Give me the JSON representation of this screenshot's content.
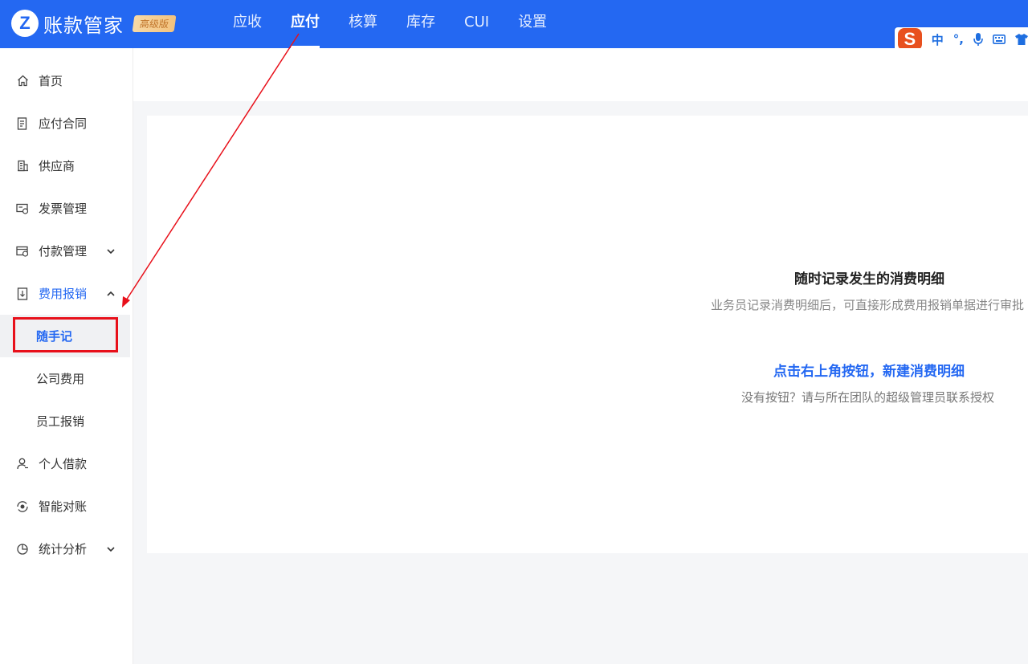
{
  "app": {
    "logo_letter": "Z",
    "name": "账款管家",
    "edition": "高级版"
  },
  "nav": {
    "items": [
      {
        "label": "应收",
        "active": false
      },
      {
        "label": "应付",
        "active": true
      },
      {
        "label": "核算",
        "active": false
      },
      {
        "label": "库存",
        "active": false
      },
      {
        "label": "CUI",
        "active": false
      },
      {
        "label": "设置",
        "active": false
      }
    ]
  },
  "ime_toolbar": {
    "logo": "S",
    "lang": "中",
    "punct": "°,",
    "icons": [
      "microphone-icon",
      "keyboard-icon",
      "skin-icon"
    ]
  },
  "sidebar": {
    "items": [
      {
        "label": "首页",
        "icon": "home-icon"
      },
      {
        "label": "应付合同",
        "icon": "contract-icon"
      },
      {
        "label": "供应商",
        "icon": "building-icon"
      },
      {
        "label": "发票管理",
        "icon": "invoice-icon"
      },
      {
        "label": "付款管理",
        "icon": "payment-icon",
        "chevron": "down"
      },
      {
        "label": "费用报销",
        "icon": "reimburse-icon",
        "chevron": "up",
        "expanded": true
      },
      {
        "label": "随手记",
        "sub": true,
        "selected": true
      },
      {
        "label": "公司费用",
        "sub": true
      },
      {
        "label": "员工报销",
        "sub": true
      },
      {
        "label": "个人借款",
        "icon": "user-icon"
      },
      {
        "label": "智能对账",
        "icon": "reconcile-icon"
      },
      {
        "label": "统计分析",
        "icon": "pie-chart-icon",
        "chevron": "down"
      }
    ]
  },
  "empty_state": {
    "title": "随时记录发生的消费明细",
    "description": "业务员记录消费明细后，可直接形成费用报销单据进行审批",
    "action": "点击右上角按钮，新建消费明细",
    "hint": "没有按钮？请与所在团队的超级管理员联系授权"
  },
  "colors": {
    "brand": "#2468f2",
    "highlight": "#e8101a",
    "ime": "#e8501e"
  }
}
